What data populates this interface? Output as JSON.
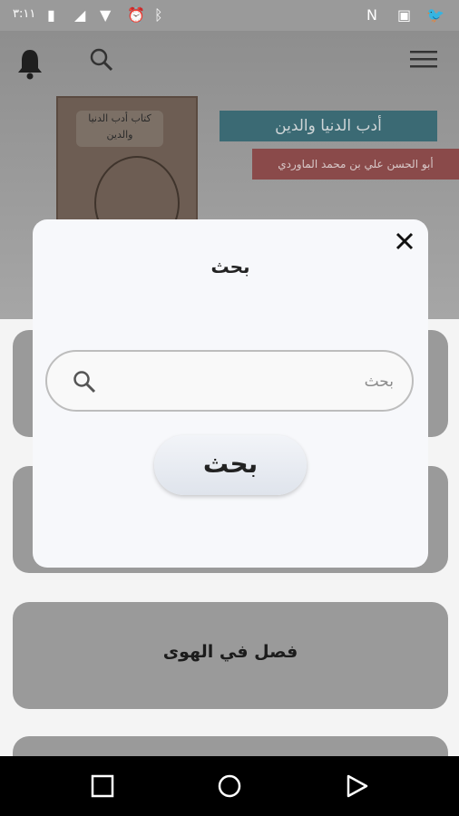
{
  "status_bar": {
    "time": "٣:١١"
  },
  "hero": {
    "book_cover_caption": "كتاب أدب الدنيا والدين",
    "title": "أدب الدنيا والدين",
    "author": "أبو الحسن علي بن محمد الماوردي"
  },
  "cards": [
    {
      "label": ""
    },
    {
      "label": ""
    },
    {
      "label": "فصل في الهوى"
    }
  ],
  "dialog": {
    "title": "بحث",
    "search_placeholder": "بحث",
    "search_value": "",
    "search_button_label": "بحث"
  },
  "icons": {
    "notifications": "bell-icon",
    "search": "search-icon",
    "menu": "hamburger-menu-icon",
    "close": "close-icon",
    "nav_back": "back-triangle-icon",
    "nav_home": "home-circle-icon",
    "nav_recents": "recents-square-icon"
  }
}
